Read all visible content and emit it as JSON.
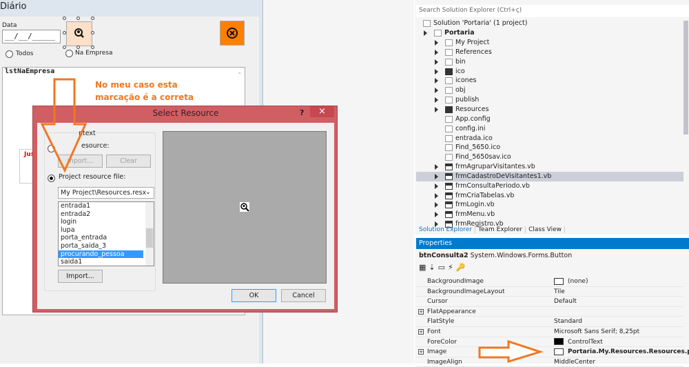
{
  "form": {
    "title": "Diário",
    "date_label": "Data",
    "date_value": "__/__/_____",
    "radio_all": "Todos",
    "radio_company": "Na Empresa",
    "list_name": "lstNaEmpresa",
    "partial_label": "Jus",
    "search_icon": "search-person-icon",
    "close_icon": "close-circle-icon"
  },
  "annotation": {
    "note_line1": "No meu caso  esta",
    "note_line2": "marcação é a correta",
    "arrow_color": "#f07820"
  },
  "dialog": {
    "title": "Select Resource",
    "help": "?",
    "close": "×",
    "group_label": "ntext",
    "local_label": "esource:",
    "import_disabled": "mport...",
    "clear": "Clear",
    "project_label": "Project resource file:",
    "resx_file": "My Project\\Resources.resx",
    "items": [
      "entrada1",
      "entrada2",
      "login",
      "lupa",
      "porta_entrada",
      "porta_saida_3",
      "procurando_pessoa",
      "saida1"
    ],
    "selected": "procurando_pessoa",
    "import": "Import...",
    "ok": "OK",
    "cancel": "Cancel"
  },
  "solution_explorer": {
    "search_placeholder": "Search Solution Explorer (Ctrl+ç)",
    "solution": "Solution 'Portaria' (1 project)",
    "project": "Portaria",
    "items": [
      {
        "label": "My Project",
        "icon": "wrench-icon",
        "expandable": true
      },
      {
        "label": "References",
        "icon": "references-icon",
        "expandable": true
      },
      {
        "label": "bin",
        "icon": "folder-icon",
        "expandable": true
      },
      {
        "label": "ico",
        "icon": "folder-dark-icon",
        "expandable": true
      },
      {
        "label": "icones",
        "icon": "folder-icon",
        "expandable": true
      },
      {
        "label": "obj",
        "icon": "folder-icon",
        "expandable": true
      },
      {
        "label": "publish",
        "icon": "folder-icon",
        "expandable": true
      },
      {
        "label": "Resources",
        "icon": "folder-dark-icon",
        "expandable": true
      },
      {
        "label": "App.config",
        "icon": "config-icon",
        "expandable": false
      },
      {
        "label": "config.ini",
        "icon": "file-icon",
        "expandable": false
      },
      {
        "label": "entrada.ico",
        "icon": "ico-file-icon",
        "expandable": false
      },
      {
        "label": "Find_5650.ico",
        "icon": "file-icon",
        "expandable": false
      },
      {
        "label": "Find_5650sav.ico",
        "icon": "file-icon",
        "expandable": false
      },
      {
        "label": "frmAgruparVisitantes.vb",
        "icon": "form-icon",
        "expandable": true
      },
      {
        "label": "frmCadastroDeVisitantes1.vb",
        "icon": "form-icon",
        "expandable": true,
        "selected": true
      },
      {
        "label": "frmConsultaPeriodo.vb",
        "icon": "form-icon",
        "expandable": true
      },
      {
        "label": "frmCriaTabelas.vb",
        "icon": "form-icon",
        "expandable": true
      },
      {
        "label": "frmLogin.vb",
        "icon": "form-icon",
        "expandable": true
      },
      {
        "label": "frmMenu.vb",
        "icon": "form-icon",
        "expandable": true
      },
      {
        "label": "frmRegistro.vb",
        "icon": "form-icon",
        "expandable": true
      }
    ],
    "tabs": [
      "Solution Explorer",
      "Team Explorer",
      "Class View"
    ],
    "active_tab": "Solution Explorer"
  },
  "properties": {
    "title": "Properties",
    "object_name": "btnConsulta2",
    "object_type": "System.Windows.Forms.Button",
    "rows": [
      {
        "name": "BackgroundImage",
        "value": "(none)",
        "swatch": "#ffffff"
      },
      {
        "name": "BackgroundImageLayout",
        "value": "Tile"
      },
      {
        "name": "Cursor",
        "value": "Default"
      },
      {
        "name": "FlatAppearance",
        "value": "",
        "expandable": true
      },
      {
        "name": "FlatStyle",
        "value": "Standard"
      },
      {
        "name": "Font",
        "value": "Microsoft Sans Serif; 8,25pt",
        "expandable": true
      },
      {
        "name": "ForeColor",
        "value": "ControlText",
        "swatch": "#000000"
      },
      {
        "name": "Image",
        "value": "Portaria.My.Resources.Resources.procu",
        "expandable": true,
        "bold": true,
        "swatch": "image"
      },
      {
        "name": "ImageAlign",
        "value": "MiddleCenter"
      }
    ]
  }
}
